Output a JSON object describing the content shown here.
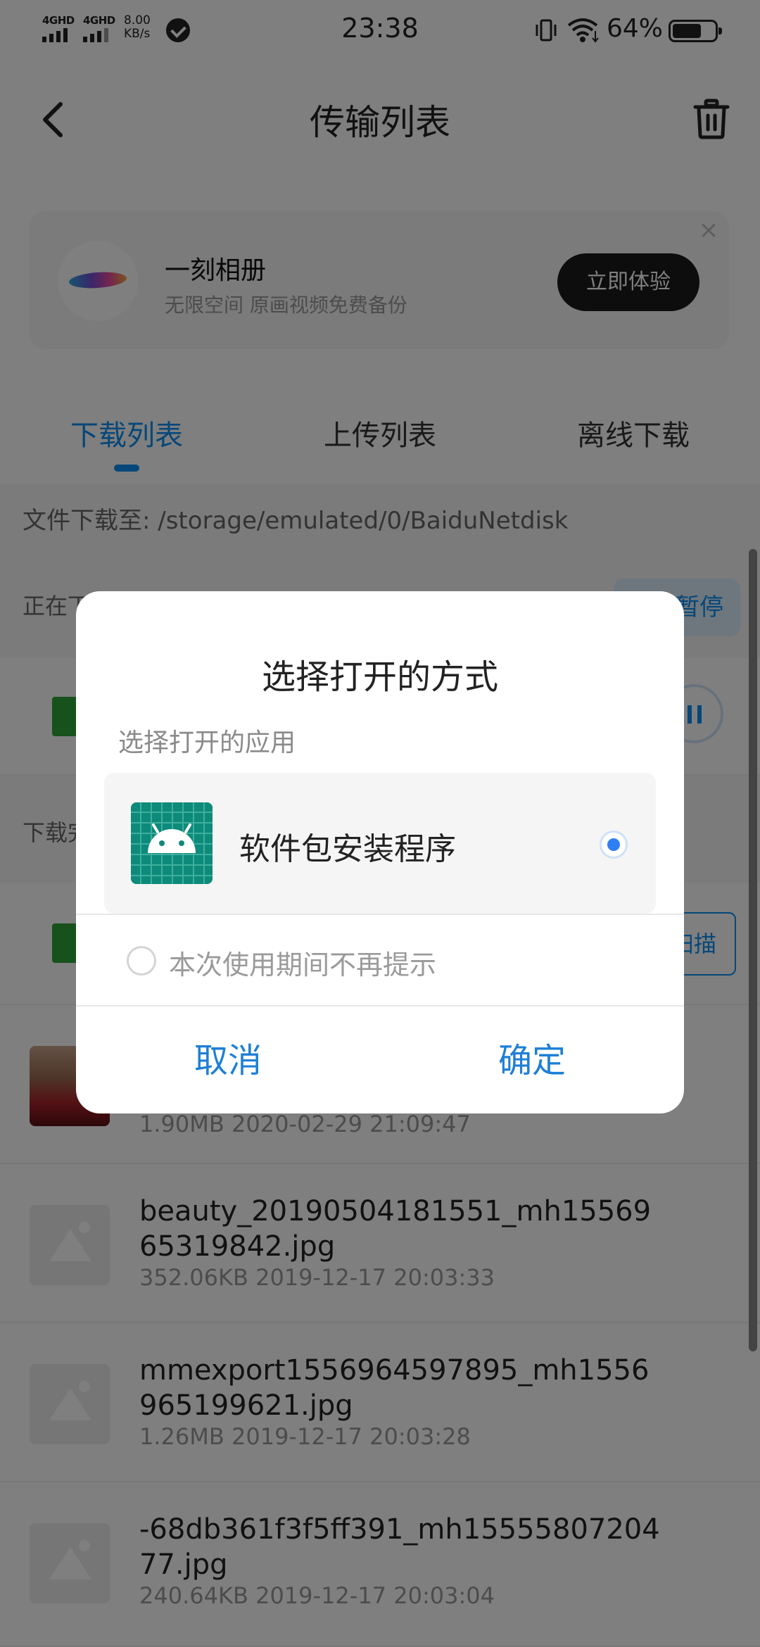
{
  "status_bar": {
    "sim1": "4GHD",
    "sim2": "4GHD",
    "speed_value": "8.00",
    "speed_unit": "KB/s",
    "time": "23:38",
    "battery": "64%",
    "icons": [
      "signal-icon",
      "check-icon",
      "vibrate-icon",
      "wifi-icon",
      "battery-icon"
    ]
  },
  "header": {
    "title": "传输列表",
    "back_icon": "chevron-left-icon",
    "trash_icon": "trash-icon"
  },
  "banner": {
    "title": "一刻相册",
    "subtitle": "无限空间  原画视频免费备份",
    "button": "立即体验",
    "close": "×"
  },
  "tabs": [
    {
      "label": "下载列表",
      "active": true
    },
    {
      "label": "上传列表",
      "active": false
    },
    {
      "label": "离线下载",
      "active": false
    }
  ],
  "path_bar": {
    "text": "文件下载至: /storage/emulated/0/BaiduNetdisk"
  },
  "background_list": {
    "downloading_label": "正在下载",
    "pause_all": "暂停",
    "done_label": "下载完成",
    "scan_button": "扫描",
    "files": [
      {
        "name": "",
        "meta": "1.90MB 2020-02-29 21:09:47"
      },
      {
        "name": "beauty_20190504181551_mh1556965319842.jpg",
        "meta": "352.06KB 2019-12-17 20:03:33"
      },
      {
        "name": "mmexport1556964597895_mh1556965199621.jpg",
        "meta": "1.26MB 2019-12-17 20:03:28"
      },
      {
        "name": "-68db361f3f5ff391_mh1555580720477.jpg",
        "meta": "240.64KB 2019-12-17 20:03:04"
      }
    ]
  },
  "dialog": {
    "title": "选择打开的方式",
    "subtitle": "选择打开的应用",
    "app_option": {
      "name": "软件包安装程序",
      "selected": true,
      "icon": "android-package-installer-icon"
    },
    "no_remind_label": "本次使用期间不再提示",
    "no_remind_checked": false,
    "cancel": "取消",
    "confirm": "确定"
  },
  "colors": {
    "accent": "#0d8ff2",
    "dialog_button": "#1e7fd6",
    "installer_icon_bg": "#0d8a7a"
  }
}
